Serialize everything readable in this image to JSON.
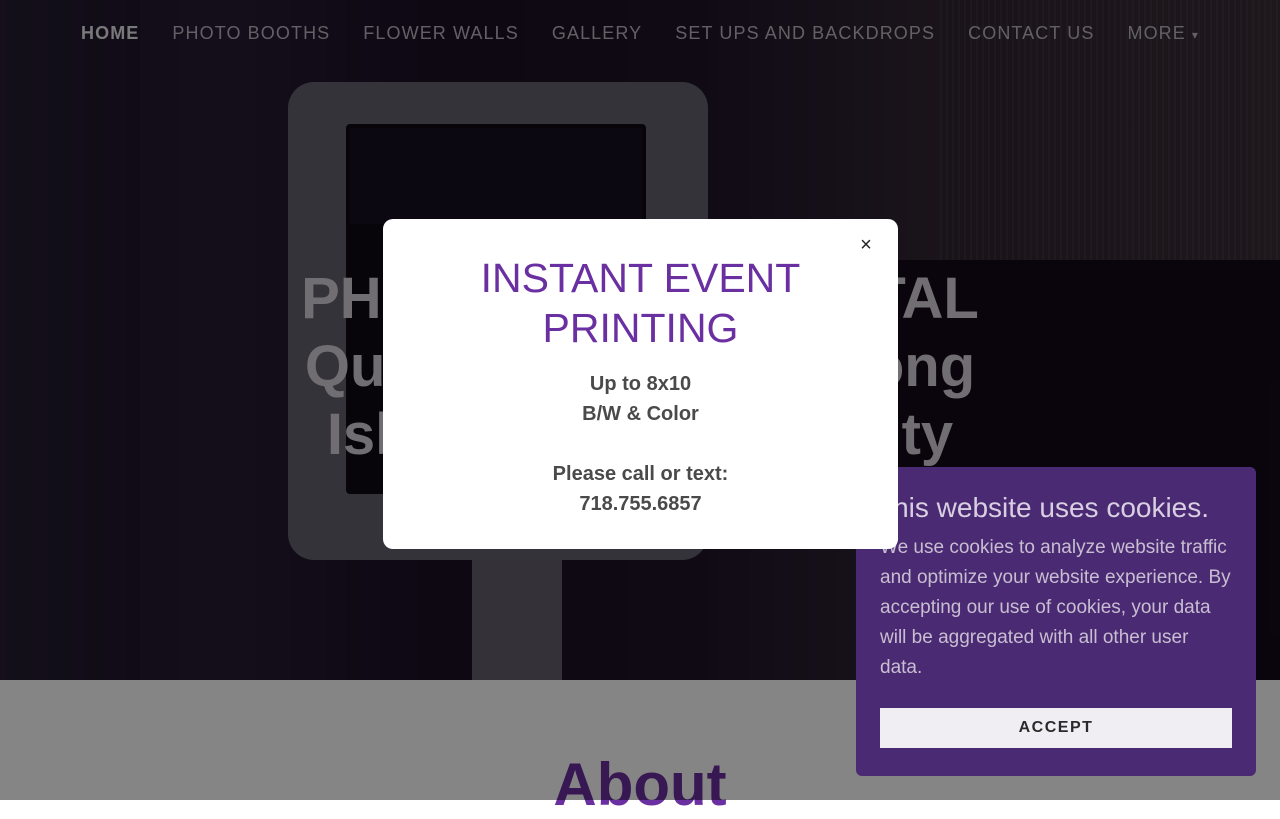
{
  "nav": {
    "items": [
      "HOME",
      "PHOTO BOOTHS",
      "FLOWER WALLS",
      "GALLERY",
      "SET UPS AND BACKDROPS",
      "CONTACT US",
      "MORE"
    ],
    "more_caret": "▾"
  },
  "hero": {
    "title_lines": [
      "PHOTO BOOTH RENTAL",
      "Queens, Brooklyn, Long",
      "Island & New York City"
    ],
    "visible_fragments": [
      "PHO",
      "TAL",
      "Que",
      "ong",
      "Isla",
      "City"
    ]
  },
  "about": {
    "heading": "About"
  },
  "modal": {
    "title": "INSTANT EVENT PRINTING",
    "lines": [
      "Up to 8x10",
      "B/W & Color",
      "",
      "Please call or text:",
      "718.755.6857"
    ],
    "close_symbol": "×"
  },
  "cookie": {
    "title": "This website uses cookies.",
    "text": "We use cookies to analyze website traffic and optimize your website experience. By accepting our use of cookies, your data will be aggregated with all other user data.",
    "accept_label": "ACCEPT"
  },
  "colors": {
    "accent": "#6a2fa0",
    "cookie_bg": "#4a2a72"
  }
}
